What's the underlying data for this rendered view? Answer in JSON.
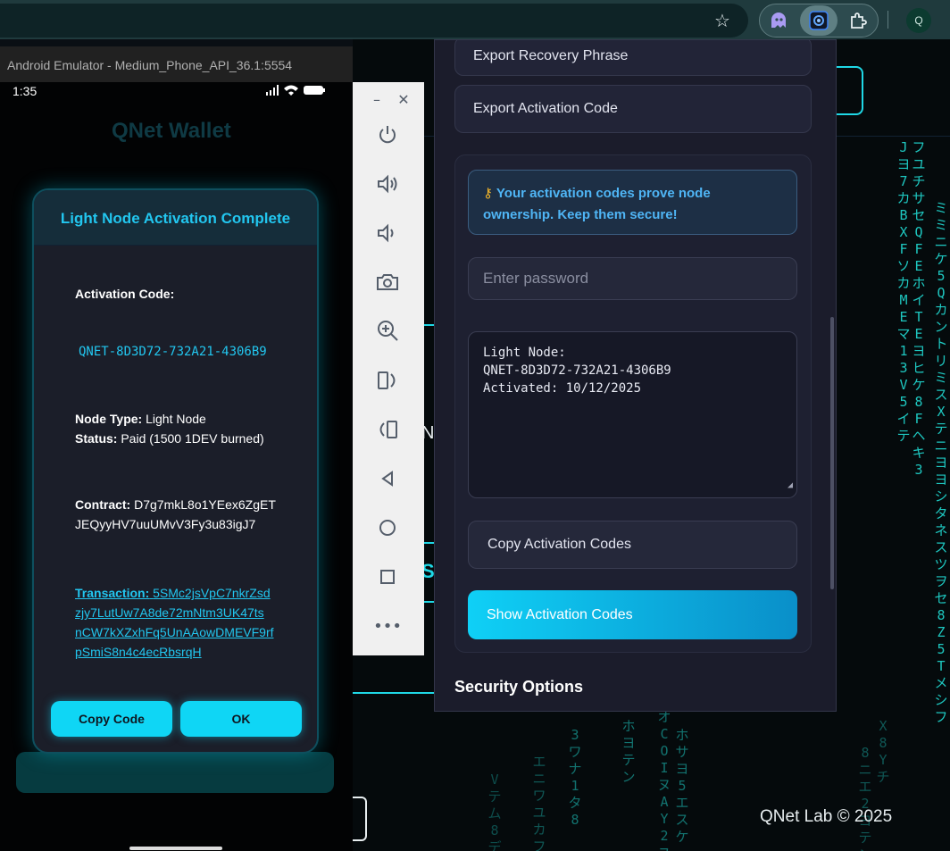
{
  "chrome": {
    "profile_initial": "Q",
    "icons": [
      "star-icon",
      "ghost-extension-icon",
      "camera-extension-icon",
      "puzzle-extensions-icon"
    ]
  },
  "background_page": {
    "copyright": "QNet Lab © 2025"
  },
  "emulator": {
    "window_title": "Android Emulator - Medium_Phone_API_36.1:5554",
    "status_time": "1:35",
    "app_title": "QNet Wallet",
    "controls": [
      "power-icon",
      "volume-up-icon",
      "volume-down-icon",
      "camera-icon",
      "zoom-icon",
      "rotate-left-icon",
      "rotate-right-icon",
      "back-icon",
      "home-icon",
      "overview-icon",
      "more-icon"
    ]
  },
  "dialog": {
    "title": "Light Node Activation Complete",
    "code_label": "Activation Code:",
    "code_value": "QNET-8D3D72-732A21-4306B9",
    "node_type_label": "Node Type:",
    "node_type_value": "Light Node",
    "status_label": "Status:",
    "status_value": "Paid (1500 1DEV burned)",
    "contract_label": "Contract:",
    "contract_value_line1": "D7g7mkL8o1YEex6ZgET",
    "contract_value_line2": "JEQyyHV7uuUMvV3Fy3u83igJ7",
    "tx_label": "Transaction:",
    "tx_line1": "5SMc2jsVpC7nkrZsd",
    "tx_line2": "zjy7LutUw7A8de72mNtm3UK47ts",
    "tx_line3": "nCW7kXZxhFq5UnAAowDMEVF9rf",
    "tx_line4": "pSmiS8n4c4ecRbsrqH",
    "copy_button": "Copy Code",
    "ok_button": "OK"
  },
  "popup": {
    "export_recovery": "Export Recovery Phrase",
    "export_activation": "Export Activation Code",
    "info_text": "Your activation codes prove node ownership. Keep them secure!",
    "password_placeholder": "Enter password",
    "codes_text": "Light Node:\nQNET-8D3D72-732A21-4306B9\nActivated: 10/12/2025",
    "copy_codes_button": "Copy Activation Codes",
    "show_codes_button": "Show Activation Codes",
    "security_heading": "Security Options"
  },
  "colors": {
    "accent": "#0fd6f5",
    "link": "#22c6ef",
    "info": "#4fb5f5",
    "matrix": "#1ec7c0"
  }
}
